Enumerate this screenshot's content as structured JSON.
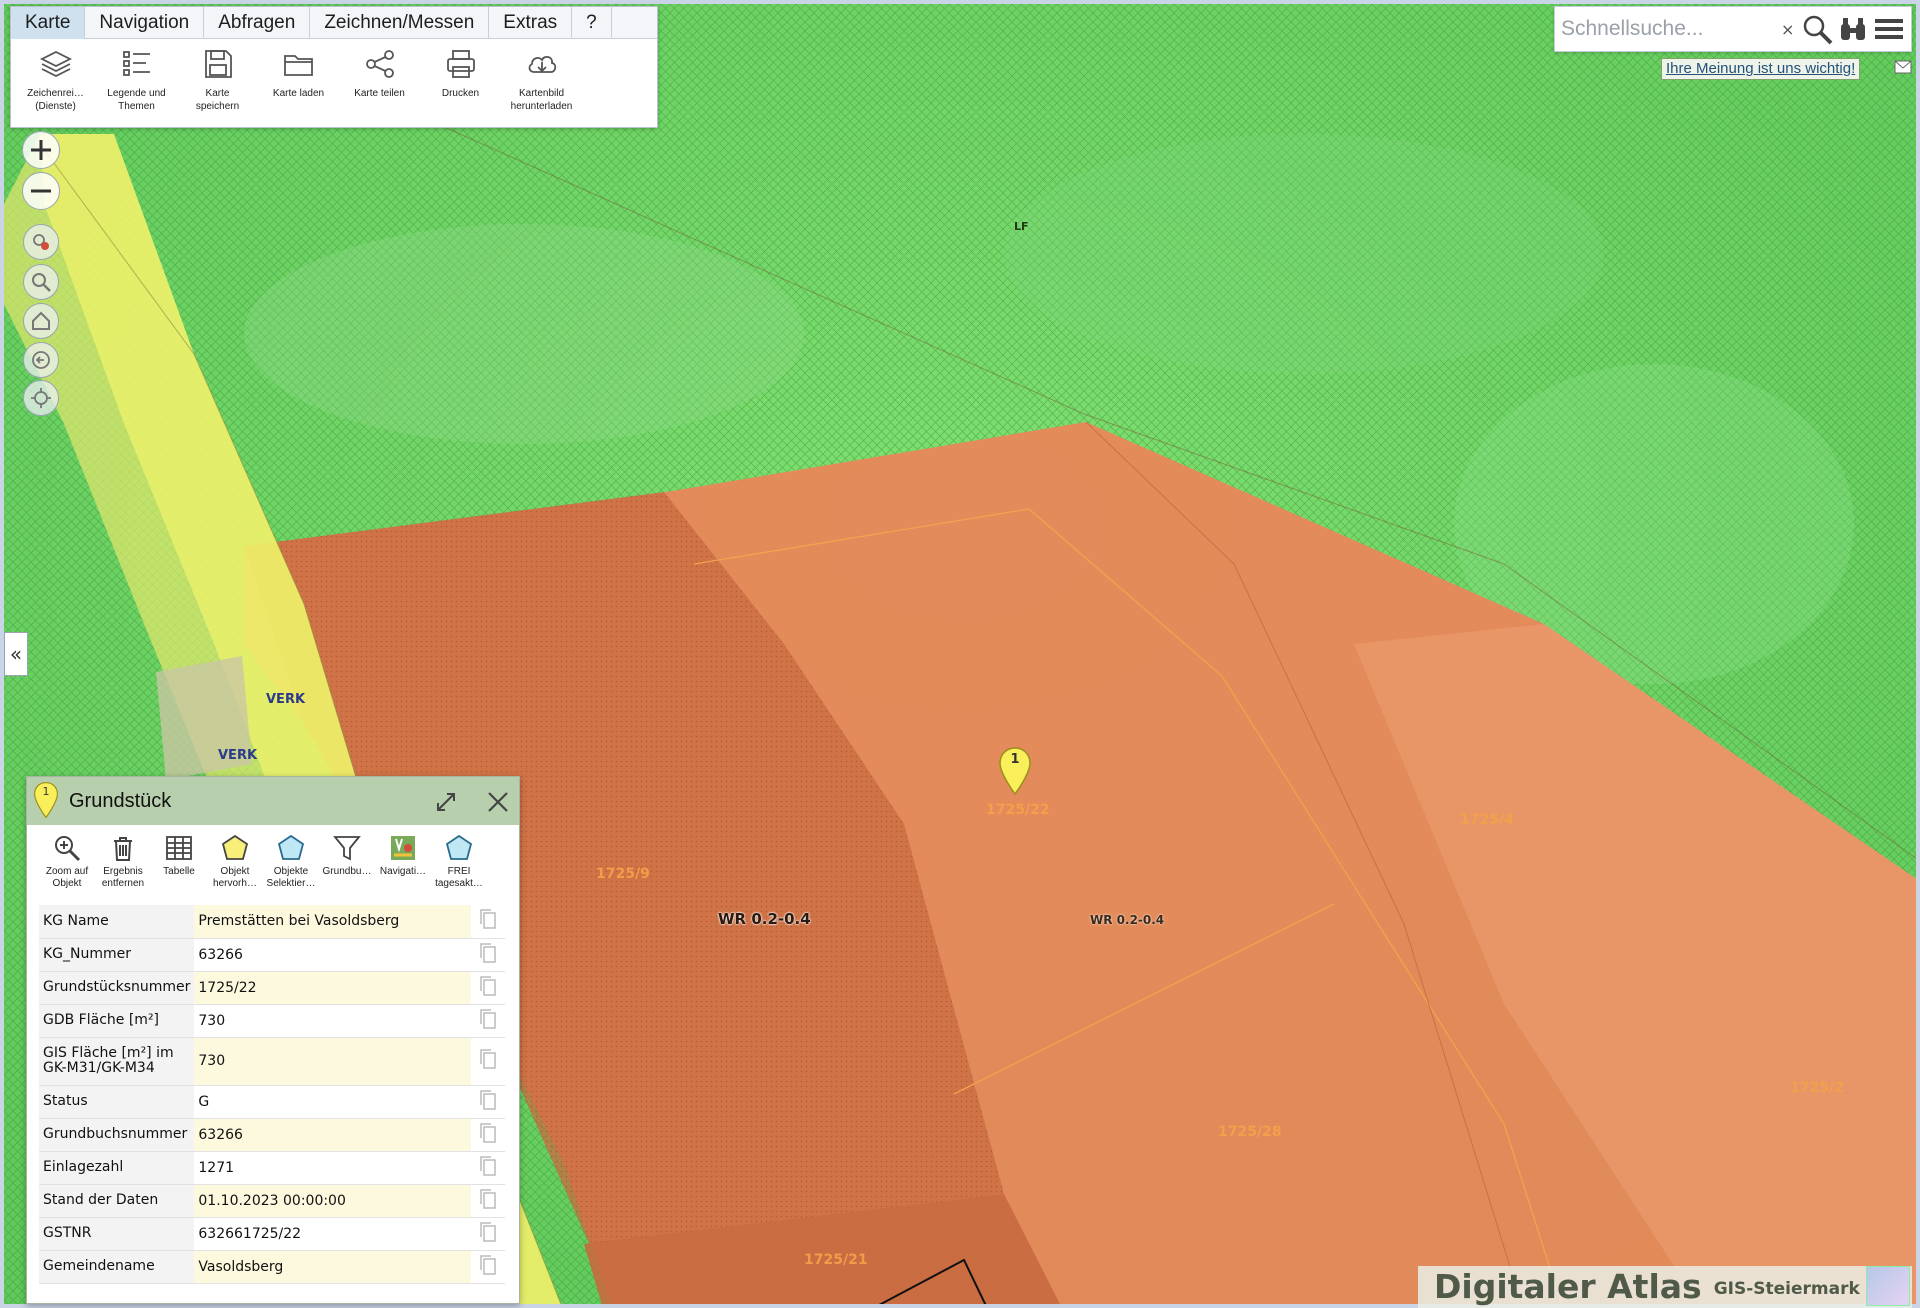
{
  "menu": {
    "tabs": [
      {
        "label": "Karte"
      },
      {
        "label": "Navigation"
      },
      {
        "label": "Abfragen"
      },
      {
        "label": "Zeichnen/Messen"
      },
      {
        "label": "Extras"
      },
      {
        "label": "?"
      }
    ],
    "tools": [
      {
        "label": "Zeichenrei…\n(Dienste)",
        "icon": "layers-icon"
      },
      {
        "label": "Legende und\nThemen",
        "icon": "legend-icon"
      },
      {
        "label": "Karte\nspeichern",
        "icon": "save-icon"
      },
      {
        "label": "Karte laden",
        "icon": "folder-icon"
      },
      {
        "label": "Karte teilen",
        "icon": "share-icon"
      },
      {
        "label": "Drucken",
        "icon": "printer-icon"
      },
      {
        "label": "Kartenbild\nherunterladen",
        "icon": "cloud-download-icon"
      }
    ]
  },
  "search": {
    "placeholder": "Schnellsuche...",
    "clear": "×"
  },
  "feedback": {
    "label": "Ihre Meinung ist uns wichtig!"
  },
  "map_labels": {
    "verk1": "VERK",
    "verk2": "VERK",
    "zone_main": "WR 0.2-0.4",
    "zone_small": "WR 0.2-0.4",
    "parcel_marker": "1725/22",
    "parcel_9": "1725/9",
    "parcel_21": "1725/21",
    "parcel_28": "1725/28",
    "parcel_right": "1725/4",
    "parcel_far_right": "1725/2",
    "lf": "LF",
    "marker_number": "1"
  },
  "result": {
    "title": "Grundstück",
    "marker_number": "1",
    "tools": [
      {
        "label": "Zoom auf\nObjekt",
        "icon": "zoom-to-object-icon"
      },
      {
        "label": "Ergebnis\nentfernen",
        "icon": "trash-icon"
      },
      {
        "label": "Tabelle",
        "icon": "table-icon"
      },
      {
        "label": "Objekt\nhervorh…",
        "icon": "highlight-polygon-icon"
      },
      {
        "label": "Objekte\nSelektier…",
        "icon": "select-polygon-icon"
      },
      {
        "label": "Grundbu…",
        "icon": "filter-icon"
      },
      {
        "label": "Navigati…",
        "icon": "navigation-icon"
      },
      {
        "label": "FREI\ntagesakt…",
        "icon": "polygon-icon"
      }
    ],
    "rows": [
      {
        "key": "KG Name",
        "value": "Premstätten bei Vasoldsberg"
      },
      {
        "key": "KG_Nummer",
        "value": "63266"
      },
      {
        "key": "Grundstücksnummer",
        "value": "1725/22"
      },
      {
        "key": "GDB Fläche [m²]",
        "value": "730"
      },
      {
        "key": "GIS Fläche [m²] im GK-M31/GK-M34",
        "value": "730"
      },
      {
        "key": "Status",
        "value": "G"
      },
      {
        "key": "Grundbuchsnummer",
        "value": "63266"
      },
      {
        "key": "Einlagezahl",
        "value": "1271"
      },
      {
        "key": "Stand der Daten",
        "value": "01.10.2023 00:00:00"
      },
      {
        "key": "GSTNR",
        "value": "632661725/22"
      },
      {
        "key": "Gemeindename",
        "value": "Vasoldsberg"
      }
    ]
  },
  "brand": {
    "main": "Digitaler Atlas",
    "sub": "GIS-Steiermark"
  },
  "colors": {
    "green_zone": "#6fd86a",
    "orange_zone": "#e9875a",
    "road": "#eef06a",
    "marker": "#f8ef5a"
  }
}
